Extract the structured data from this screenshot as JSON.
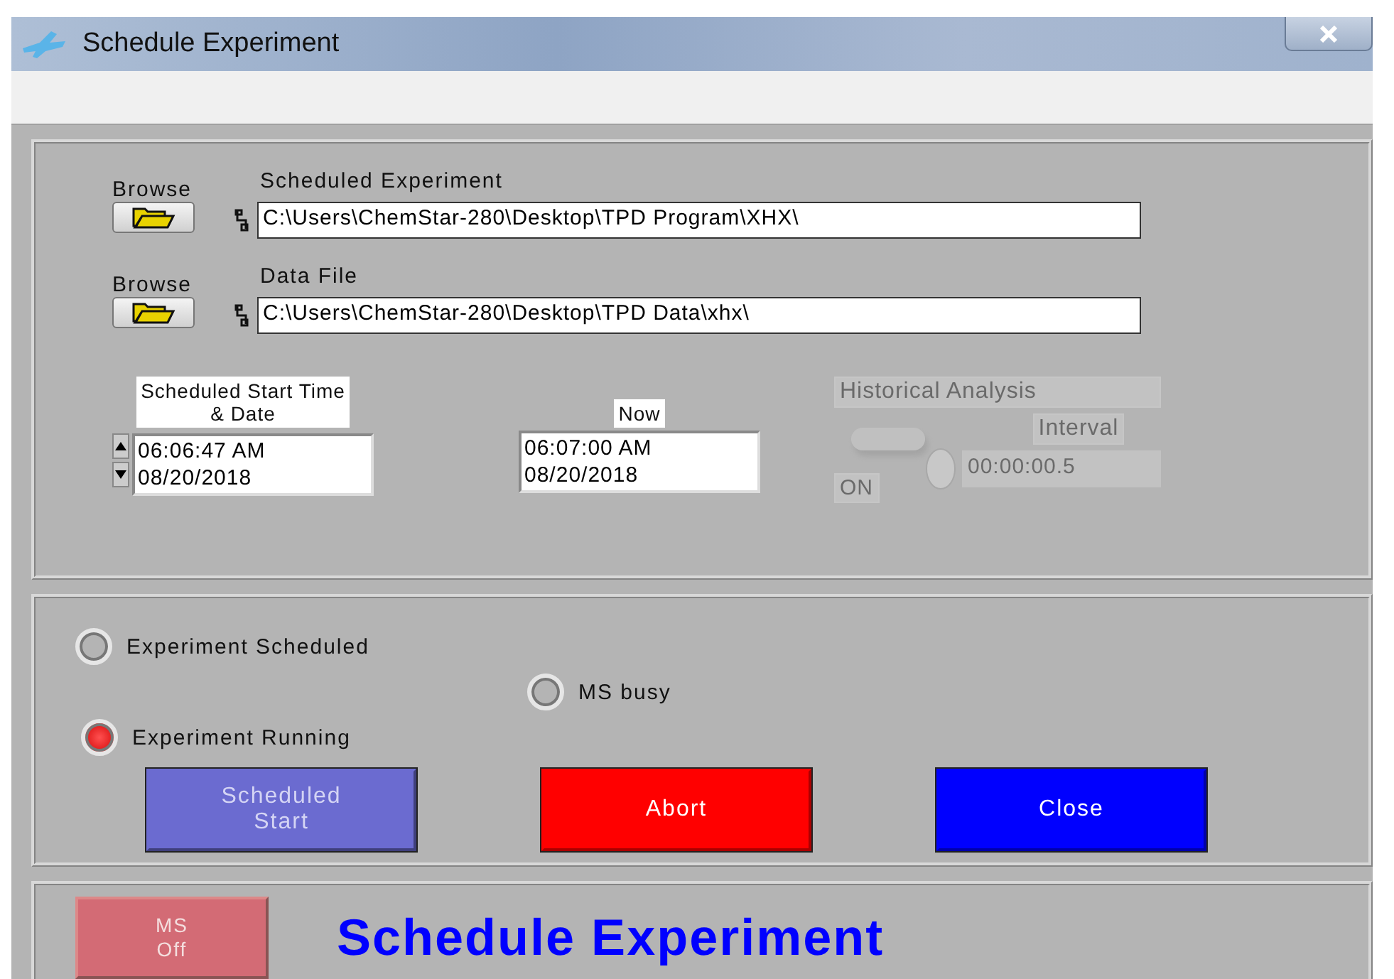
{
  "window": {
    "title": "Schedule Experiment"
  },
  "files": [
    {
      "browse": "Browse",
      "label": "Scheduled Experiment",
      "path": "C:\\Users\\ChemStar-280\\Desktop\\TPD Program\\XHX\\"
    },
    {
      "browse": "Browse",
      "label": "Data File",
      "path": "C:\\Users\\ChemStar-280\\Desktop\\TPD Data\\xhx\\"
    }
  ],
  "scheduled": {
    "label": "Scheduled Start Time & Date",
    "time": "06:06:47 AM",
    "date": "08/20/2018"
  },
  "now": {
    "label": "Now",
    "time": "06:07:00 AM",
    "date": "08/20/2018"
  },
  "historical": {
    "label": "Historical Analysis",
    "state_label": "ON",
    "on": false,
    "disabled": true
  },
  "interval": {
    "label": "Interval",
    "value": "00:00:00.5",
    "disabled": true
  },
  "indicators": [
    {
      "label": "Experiment Scheduled",
      "lit": false
    },
    {
      "label": "MS busy",
      "lit": false
    },
    {
      "label": "Experiment Running",
      "lit": true
    }
  ],
  "buttons": [
    {
      "label": "Scheduled Start",
      "color": "#6b6bd0",
      "disabled": true
    },
    {
      "label": "Abort",
      "color": "#ff0000",
      "disabled": false
    },
    {
      "label": "Close",
      "color": "#0000ff",
      "disabled": false
    }
  ],
  "footer": {
    "ms_button": {
      "label": "MS Off",
      "on": false
    },
    "heading": "Schedule Experiment"
  }
}
